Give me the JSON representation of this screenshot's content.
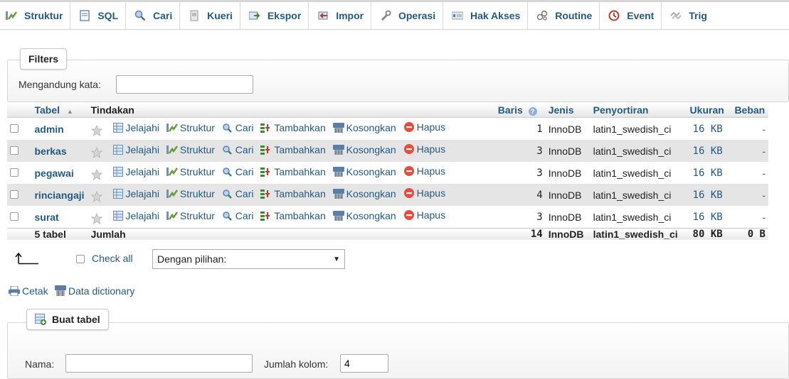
{
  "tabs": [
    {
      "label": "Struktur",
      "icon": "structure-icon",
      "active": true
    },
    {
      "label": "SQL",
      "icon": "sql-icon"
    },
    {
      "label": "Cari",
      "icon": "search-icon"
    },
    {
      "label": "Kueri",
      "icon": "query-icon"
    },
    {
      "label": "Ekspor",
      "icon": "export-icon"
    },
    {
      "label": "Impor",
      "icon": "import-icon"
    },
    {
      "label": "Operasi",
      "icon": "wrench-icon"
    },
    {
      "label": "Hak Akses",
      "icon": "privileges-icon"
    },
    {
      "label": "Routine",
      "icon": "routine-icon"
    },
    {
      "label": "Event",
      "icon": "clock-icon"
    },
    {
      "label": "Trig",
      "icon": "trigger-icon"
    }
  ],
  "filters": {
    "legend": "Filters",
    "contains_label": "Mengandung kata:",
    "contains_value": ""
  },
  "table": {
    "headers": {
      "tabel": "Tabel",
      "tindakan": "Tindakan",
      "baris": "Baris",
      "jenis": "Jenis",
      "penyortiran": "Penyortiran",
      "ukuran": "Ukuran",
      "beban": "Beban"
    },
    "actions": {
      "jelajahi": "Jelajahi",
      "struktur": "Struktur",
      "cari": "Cari",
      "tambahkan": "Tambahkan",
      "kosongkan": "Kosongkan",
      "hapus": "Hapus"
    },
    "rows": [
      {
        "name": "admin",
        "rows": "1",
        "engine": "InnoDB",
        "collation": "latin1_swedish_ci",
        "size": "16 KB",
        "overhead": "-"
      },
      {
        "name": "berkas",
        "rows": "3",
        "engine": "InnoDB",
        "collation": "latin1_swedish_ci",
        "size": "16 KB",
        "overhead": "-"
      },
      {
        "name": "pegawai",
        "rows": "3",
        "engine": "InnoDB",
        "collation": "latin1_swedish_ci",
        "size": "16 KB",
        "overhead": "-"
      },
      {
        "name": "rinciangaji",
        "rows": "4",
        "engine": "InnoDB",
        "collation": "latin1_swedish_ci",
        "size": "16 KB",
        "overhead": "-"
      },
      {
        "name": "surat",
        "rows": "3",
        "engine": "InnoDB",
        "collation": "latin1_swedish_ci",
        "size": "16 KB",
        "overhead": "-"
      }
    ],
    "footer": {
      "count": "5 tabel",
      "label": "Jumlah",
      "rows": "14",
      "engine": "InnoDB",
      "collation": "latin1_swedish_ci",
      "size": "80 KB",
      "overhead": "0 B"
    }
  },
  "bulk": {
    "check_all": "Check all",
    "with_selected": "Dengan pilihan:"
  },
  "links": {
    "print": "Cetak",
    "data_dictionary": "Data dictionary"
  },
  "create_table": {
    "legend": "Buat tabel",
    "name_label": "Nama:",
    "name_value": "",
    "columns_label": "Jumlah kolom:",
    "columns_value": "4"
  }
}
